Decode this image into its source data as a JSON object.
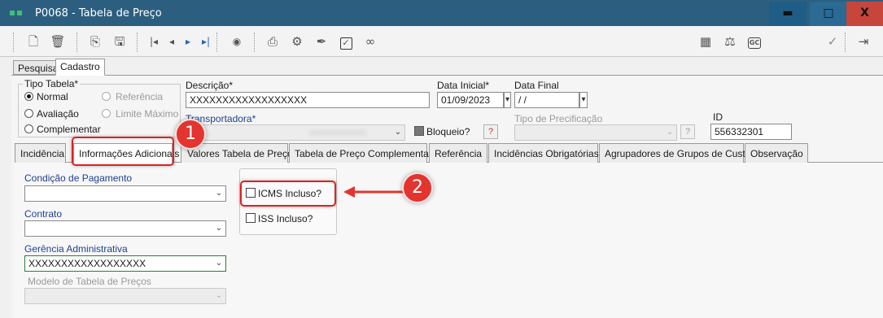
{
  "window": {
    "title": "P0068 - Tabela de Preço",
    "min_label": "▬",
    "max_label": "□",
    "close_label": "X"
  },
  "main_tabs": [
    {
      "label": "Pesquisa"
    },
    {
      "label": "Cadastro"
    }
  ],
  "form": {
    "tipo_tabela": {
      "label": "Tipo Tabela*",
      "options": [
        {
          "label": "Normal",
          "selected": true,
          "enabled": true
        },
        {
          "label": "Referência",
          "selected": false,
          "enabled": false
        },
        {
          "label": "Avaliação",
          "selected": false,
          "enabled": true
        },
        {
          "label": "Limite Máximo",
          "selected": false,
          "enabled": false
        },
        {
          "label": "Complementar",
          "selected": false,
          "enabled": true
        }
      ]
    },
    "descricao": {
      "label": "Descrição*",
      "value": "XXXXXXXXXXXXXXXXXX"
    },
    "data_inicial": {
      "label": "Data Inicial*",
      "value": "01/09/2023"
    },
    "data_final": {
      "label": "Data Final",
      "value": " /  /"
    },
    "transportadora": {
      "label": "Transportadora*",
      "value": ""
    },
    "bloqueio": {
      "label": "Bloqueio?",
      "help": "?"
    },
    "tipo_precificacao": {
      "label": "Tipo de Precificação",
      "help": "?"
    },
    "id": {
      "label": "ID",
      "value": "556332301"
    }
  },
  "sub_tabs": [
    {
      "label": "Incidência"
    },
    {
      "label": "Informações Adicionais"
    },
    {
      "label": "Valores Tabela de Preço"
    },
    {
      "label": "Tabela de Preço Complementar"
    },
    {
      "label": "Referência"
    },
    {
      "label": "Incidências Obrigatórias"
    },
    {
      "label": "Agrupadores de Grupos de Custo"
    },
    {
      "label": "Observação"
    }
  ],
  "adicionais": {
    "condicao_pagamento": {
      "label": "Condição de Pagamento",
      "value": ""
    },
    "contrato": {
      "label": "Contrato",
      "value": ""
    },
    "gerencia": {
      "label": "Gerência Administrativa",
      "value": "XXXXXXXXXXXXXXXXXX"
    },
    "modelo": {
      "label": "Modelo de Tabela de Preços",
      "value": ""
    },
    "icms": {
      "label": "ICMS Incluso?",
      "checked": false
    },
    "iss": {
      "label": "ISS Incluso?",
      "checked": false
    }
  },
  "annotations": {
    "badge1": "1",
    "badge2": "2",
    "color": "#e3342f"
  },
  "toolbar_icons": [
    "new-icon",
    "delete-icon",
    "copy-icon",
    "save-icon",
    "first-icon",
    "prev-icon",
    "next-icon",
    "last-icon",
    "search-binoculars-icon",
    "print-icon",
    "gear-icon",
    "attach-icon",
    "check-box-icon",
    "link-icon",
    "spreadsheet-icon",
    "balance-icon",
    "gc-icon",
    "confirm-icon",
    "exit-icon"
  ]
}
